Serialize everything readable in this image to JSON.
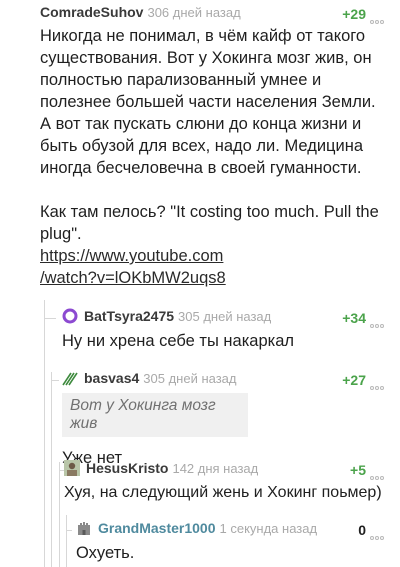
{
  "comments": [
    {
      "author": "ComradeSuhov",
      "time": "306 дней назад",
      "rating": "+29",
      "body": "Никогда не понимал, в чём кайф от такого существования. Вот у Хокинга мозг жив, он полностью парализованный умнее и полезнее большей части населения Земли. А вот так пускать слюни до конца жизни и быть обузой для всех, надо ли. Медицина иногда бесчеловечна в своей гуманности.",
      "body2": "Как там пелось? \"It costing too much. Pull the plug\".",
      "link1": "https://www.youtube.com",
      "link2": "/watch?v=lOKbMW2uqs8"
    },
    {
      "author": "BatTsyra2475",
      "time": "305 дней назад",
      "rating": "+34",
      "body": "Ну ни хрена себе ты накаркал"
    },
    {
      "author": "basvas4",
      "time": "305 дней назад",
      "rating": "+27",
      "quote": "Вот у Хокинга мозг жив",
      "body": "Уже нет"
    },
    {
      "author": "HesusKristo",
      "time": "142 дня назад",
      "rating": "+5",
      "body": "Хуя, на следующий жень и Хокинг поьмер)"
    },
    {
      "author": "GrandMaster1000",
      "time": "1 секунда назад",
      "rating": "0",
      "body": "Охуеть."
    }
  ],
  "colors": {
    "positive": "#4ba34b",
    "neutral": "#1f1f1f",
    "author_highlight": "#4f8a9e"
  }
}
